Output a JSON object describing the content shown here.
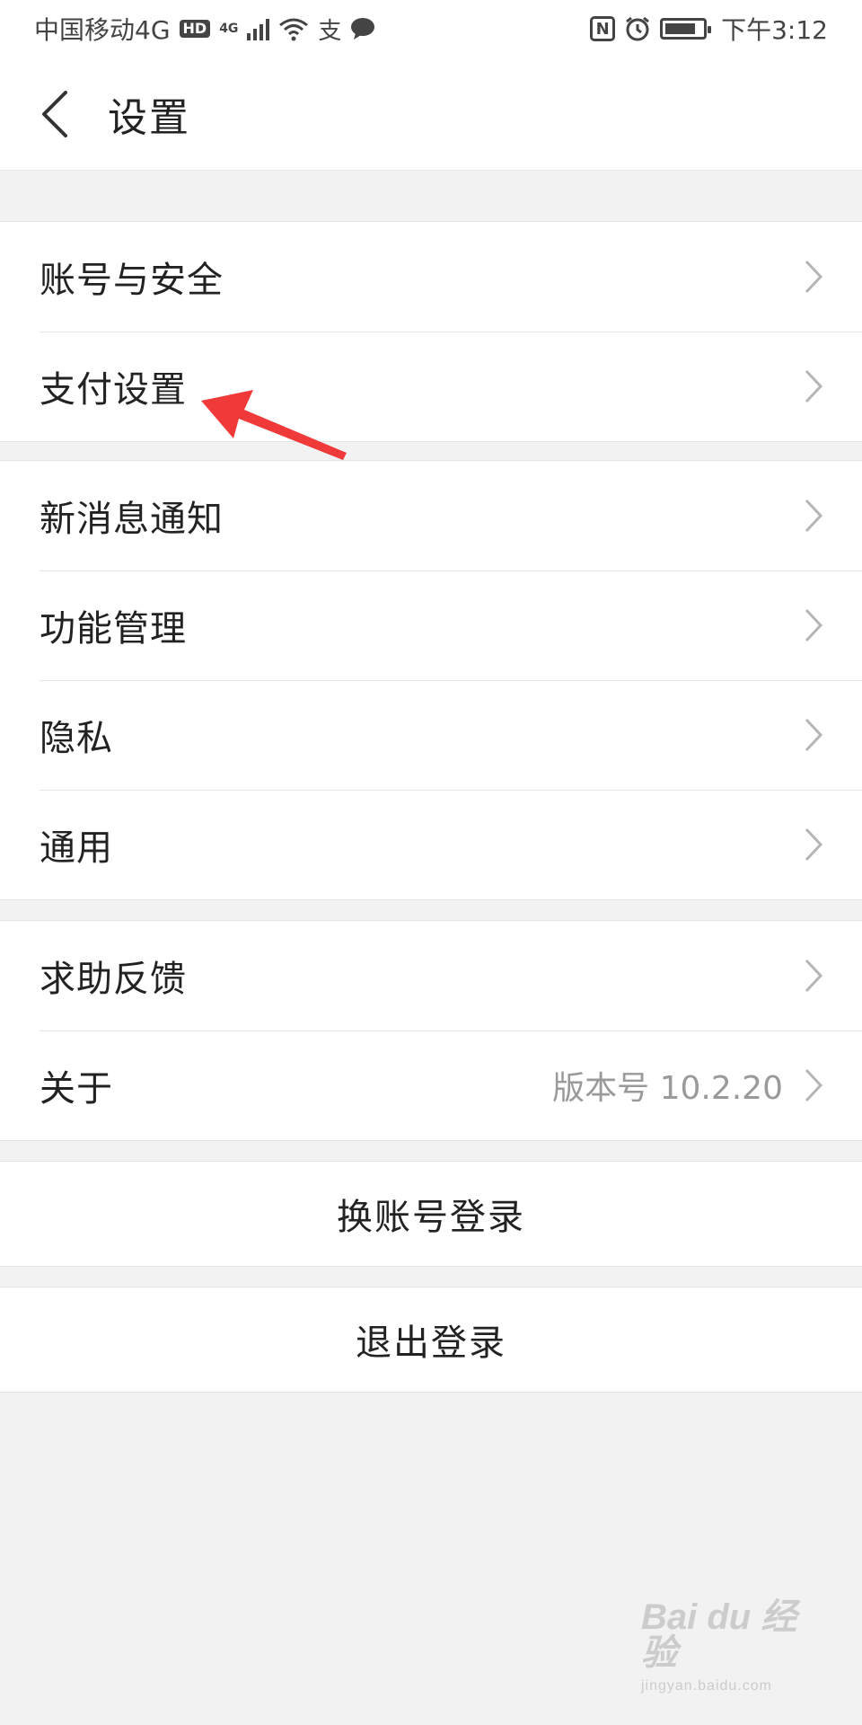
{
  "status_bar": {
    "carrier": "中国移动4G",
    "hd_badge": "HD",
    "network_small": "4G",
    "alipay_glyph": "支",
    "nfc_glyph": "N",
    "time": "下午3:12"
  },
  "title_bar": {
    "title": "设置",
    "back_icon": "chevron-left-icon"
  },
  "groups": [
    {
      "items": [
        {
          "label": "账号与安全"
        },
        {
          "label": "支付设置"
        }
      ]
    },
    {
      "items": [
        {
          "label": "新消息通知"
        },
        {
          "label": "功能管理"
        },
        {
          "label": "隐私"
        },
        {
          "label": "通用"
        }
      ]
    },
    {
      "items": [
        {
          "label": "求助反馈"
        },
        {
          "label": "关于",
          "value": "版本号 10.2.20"
        }
      ]
    }
  ],
  "actions": {
    "switch_account": "换账号登录",
    "logout": "退出登录"
  },
  "annotation": {
    "color": "#f03a3a",
    "icon": "arrow-icon"
  },
  "watermark": {
    "logo": "Bai du 经验",
    "sub": "jingyan.baidu.com"
  },
  "colors": {
    "background": "#f2f2f2",
    "surface": "#ffffff",
    "text_primary": "#222222",
    "text_secondary": "#9a9a9a",
    "chevron": "#b5b5b5"
  }
}
